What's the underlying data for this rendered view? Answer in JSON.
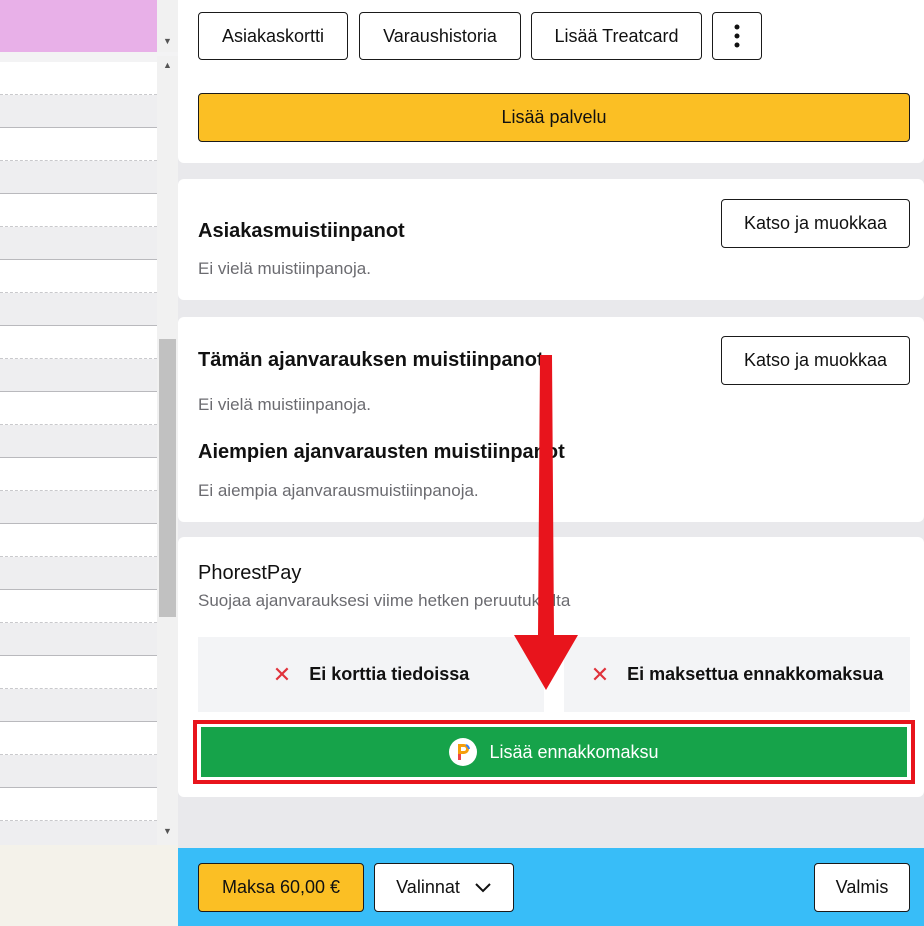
{
  "toolbar": {
    "customer_card": "Asiakaskortti",
    "booking_history": "Varaushistoria",
    "add_treatcard": "Lisää Treatcard",
    "add_service": "Lisää palvelu"
  },
  "customer_notes": {
    "title": "Asiakasmuistiinpanot",
    "empty": "Ei vielä muistiinpanoja.",
    "view_edit": "Katso ja muokkaa"
  },
  "appointment_notes": {
    "title": "Tämän ajanvarauksen muistiinpanot",
    "empty": "Ei vielä muistiinpanoja.",
    "view_edit": "Katso ja muokkaa",
    "previous_title": "Aiempien ajanvarausten muistiinpanot",
    "previous_empty": "Ei aiempia ajanvarausmuistiinpanoja."
  },
  "phorest_pay": {
    "title": "PhorestPay",
    "subtitle": "Suojaa ajanvarauksesi viime hetken peruutuksilta",
    "no_card": "Ei korttia tiedoissa",
    "no_deposit": "Ei maksettua ennakkomaksua",
    "add_deposit": "Lisää ennakkomaksu"
  },
  "footer": {
    "pay": "Maksa 60,00 €",
    "options": "Valinnat",
    "done": "Valmis"
  },
  "colors": {
    "accent_yellow": "#fbbf24",
    "pay_green": "#16a34a",
    "footer_blue": "#38bdf8",
    "highlight_red": "#e8141c",
    "event_pink": "#e8b0e8"
  },
  "icons": [
    "kebab-menu-icon",
    "close-x-icon",
    "phorest-logo-icon",
    "chevron-down-icon",
    "arrow-annotation"
  ]
}
